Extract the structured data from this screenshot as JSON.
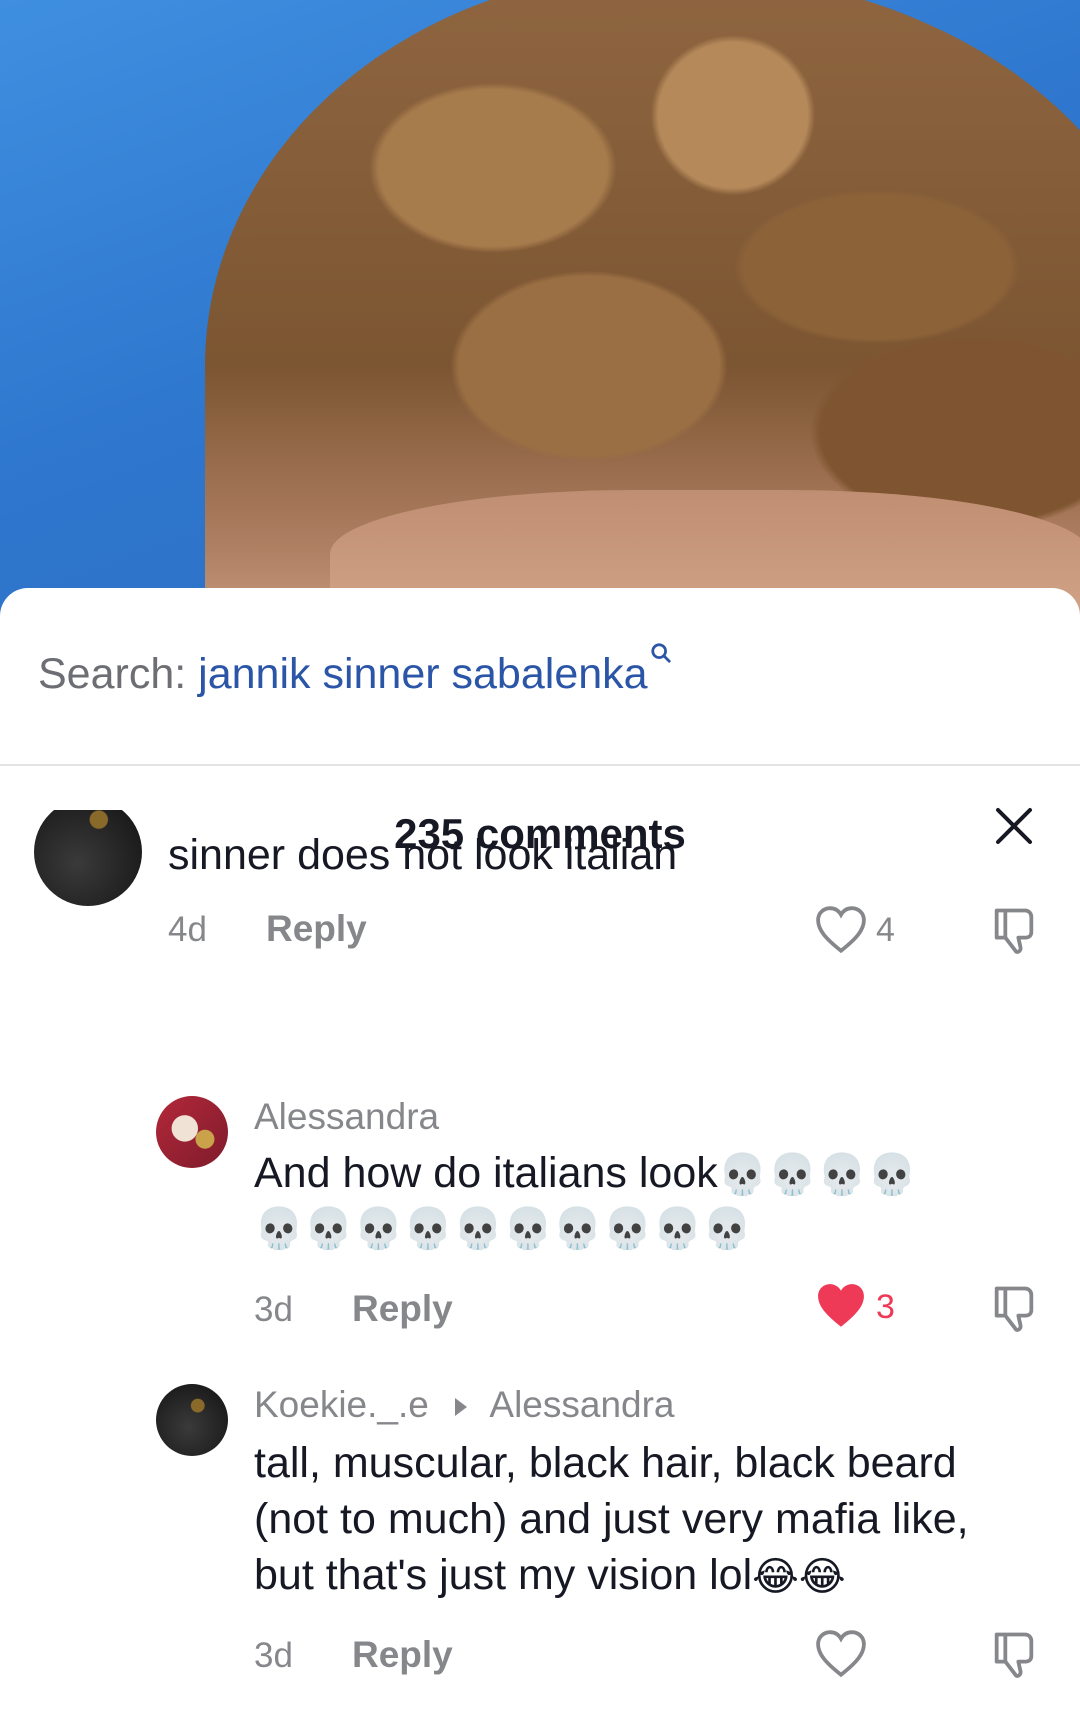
{
  "search": {
    "prefix": "Search:",
    "query": "jannik sinner sabalenka"
  },
  "comments_header": {
    "title": "235 comments"
  },
  "comments": [
    {
      "text": "sinner does not look italian",
      "age": "4d",
      "reply_label": "Reply",
      "likes": "4",
      "liked": false
    },
    {
      "username": "Alessandra",
      "text_line1": "And how do italians look",
      "emoji_line1": "💀💀💀💀",
      "emoji_line2": "💀💀💀💀💀💀💀💀💀💀",
      "age": "3d",
      "reply_label": "Reply",
      "likes": "3",
      "liked": true,
      "like_color": "#ee3a57"
    },
    {
      "username": "Koekie._.e",
      "reply_to": "Alessandra",
      "text_line1": "tall, muscular, black hair, black beard",
      "text_line2": "(not to much) and just very mafia like,",
      "text_line3": "but that's just my vision lol",
      "emoji_line3": "😂😂",
      "age": "3d",
      "reply_label": "Reply",
      "likes": "",
      "liked": false
    }
  ]
}
